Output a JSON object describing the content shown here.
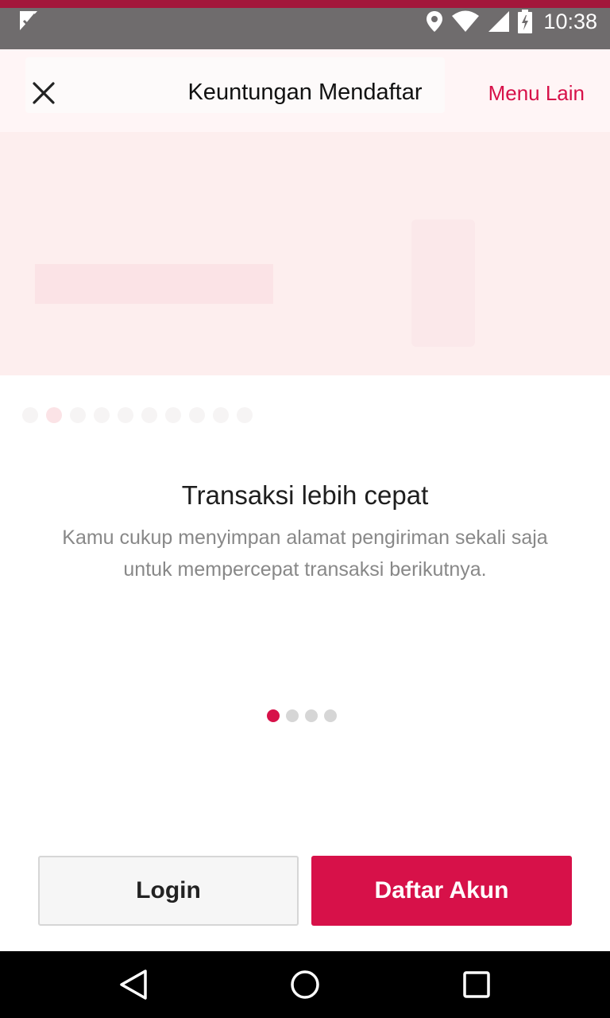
{
  "status_bar": {
    "time": "10:38",
    "icons": [
      "notification-check-icon",
      "location-icon",
      "wifi-icon",
      "signal-icon",
      "battery-charging-icon"
    ]
  },
  "sheet": {
    "title": "Keuntungan Mendaftar",
    "close_icon": "close-icon",
    "menu_label": "Menu Lain"
  },
  "slide": {
    "title": "Transaksi lebih cepat",
    "description": "Kamu cukup menyimpan alamat pengiriman sekali saja untuk mempercepat transaksi berikutnya.",
    "page_count": 4,
    "active_page": 1
  },
  "buttons": {
    "login_label": "Login",
    "register_label": "Daftar Akun"
  },
  "nav_bar": {
    "icons": [
      "back-icon",
      "home-icon",
      "recents-icon"
    ]
  },
  "colors": {
    "accent": "#d71149",
    "status_bar": "#6f6c6d",
    "status_accent": "#a3173b"
  }
}
